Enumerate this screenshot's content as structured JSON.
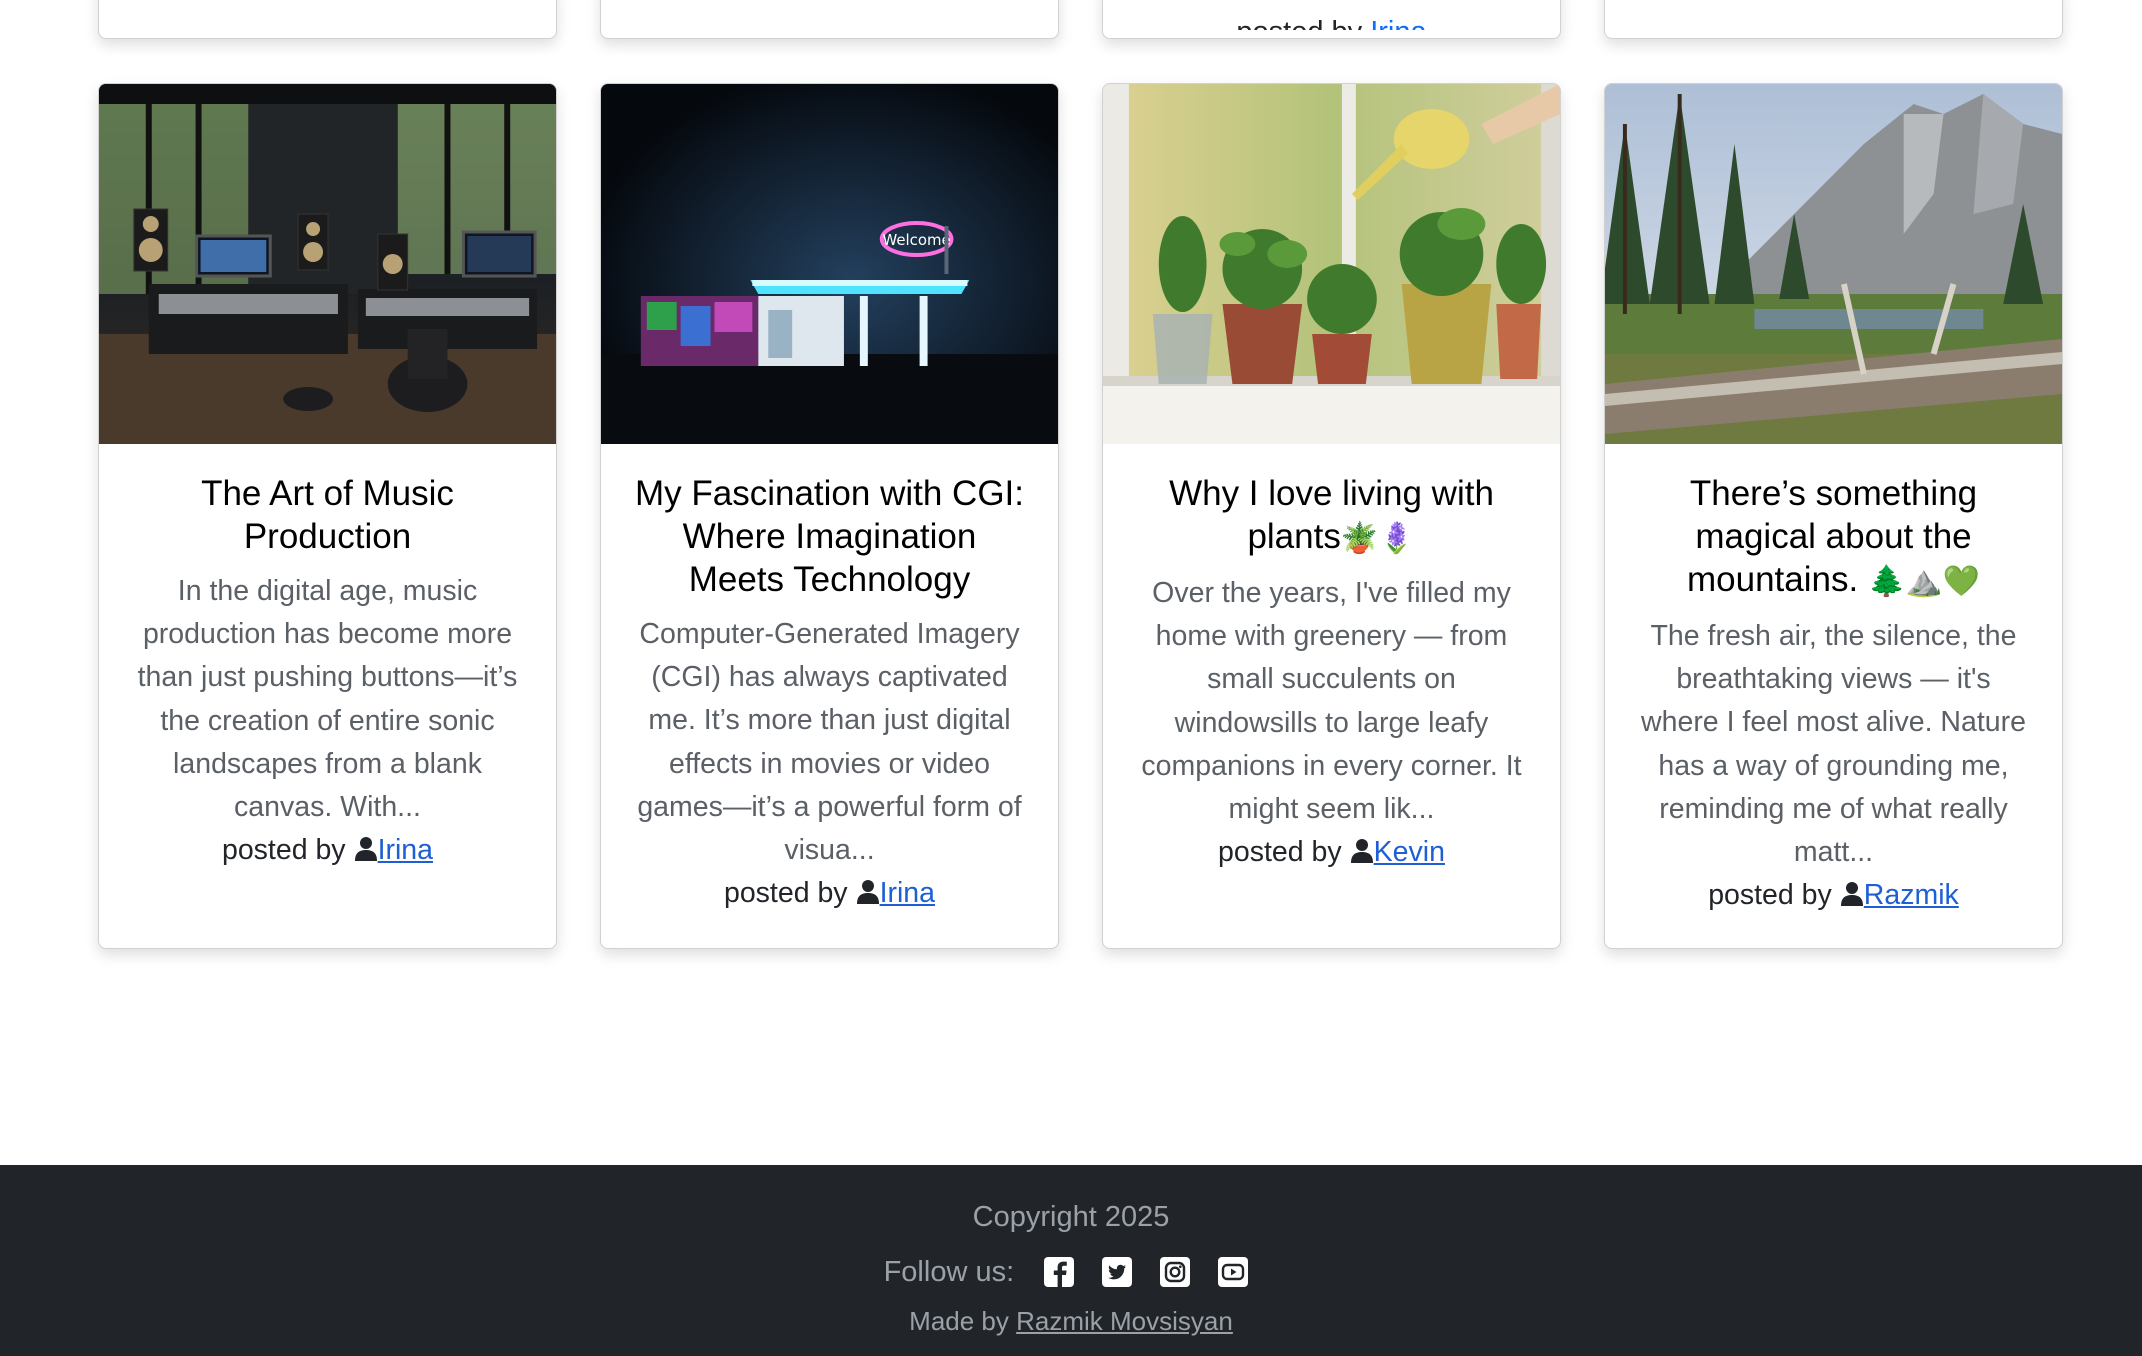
{
  "top_row": {
    "partial_posted_text": "posted by",
    "partial_author": "Irina"
  },
  "posts": [
    {
      "title": "The Art of Music Production",
      "excerpt": "In the digital age, music production has become more than just pushing buttons—it’s the creation of entire sonic landscapes from a blank canvas. With...",
      "posted_label": "posted by",
      "author": "Irina",
      "image": "music-studio-image"
    },
    {
      "title": "My Fascination with CGI: Where Imagination Meets Technology",
      "excerpt": "Computer-Generated Imagery (CGI) has always captivated me. It’s more than just digital effects in movies or video games—it’s a powerful form of visua...",
      "posted_label": "posted by",
      "author": "Irina",
      "image": "neon-gas-station-image",
      "image_sign_text": "Welcome"
    },
    {
      "title": "Why I love living with plants",
      "title_emoji": "🪴🪻",
      "excerpt": "Over the years, I've filled my home with greenery — from small succulents on windowsills to large leafy companions in every corner. It might seem lik...",
      "posted_label": "posted by",
      "author": "Kevin",
      "image": "houseplants-window-image"
    },
    {
      "title": "There’s something magical about the mountains.",
      "title_emoji": "🌲⛰️💚",
      "excerpt": "The fresh air, the silence, the breathtaking views — it's where I feel most alive. Nature has a way of grounding me, reminding me of what really matt...",
      "posted_label": "posted by",
      "author": "Razmik",
      "image": "mountain-forest-image"
    }
  ],
  "footer": {
    "copyright": "Copyright 2025",
    "follow_label": "Follow us:",
    "social_icons": [
      "facebook-icon",
      "twitter-icon",
      "instagram-icon",
      "youtube-icon"
    ],
    "made_by_label": "Made by",
    "made_by_name": "Razmik Movsisyan"
  },
  "colors": {
    "link": "#1f5fd6",
    "footer_bg": "#212529",
    "footer_text": "#9aa1a8",
    "excerpt_text": "#5b6066"
  }
}
